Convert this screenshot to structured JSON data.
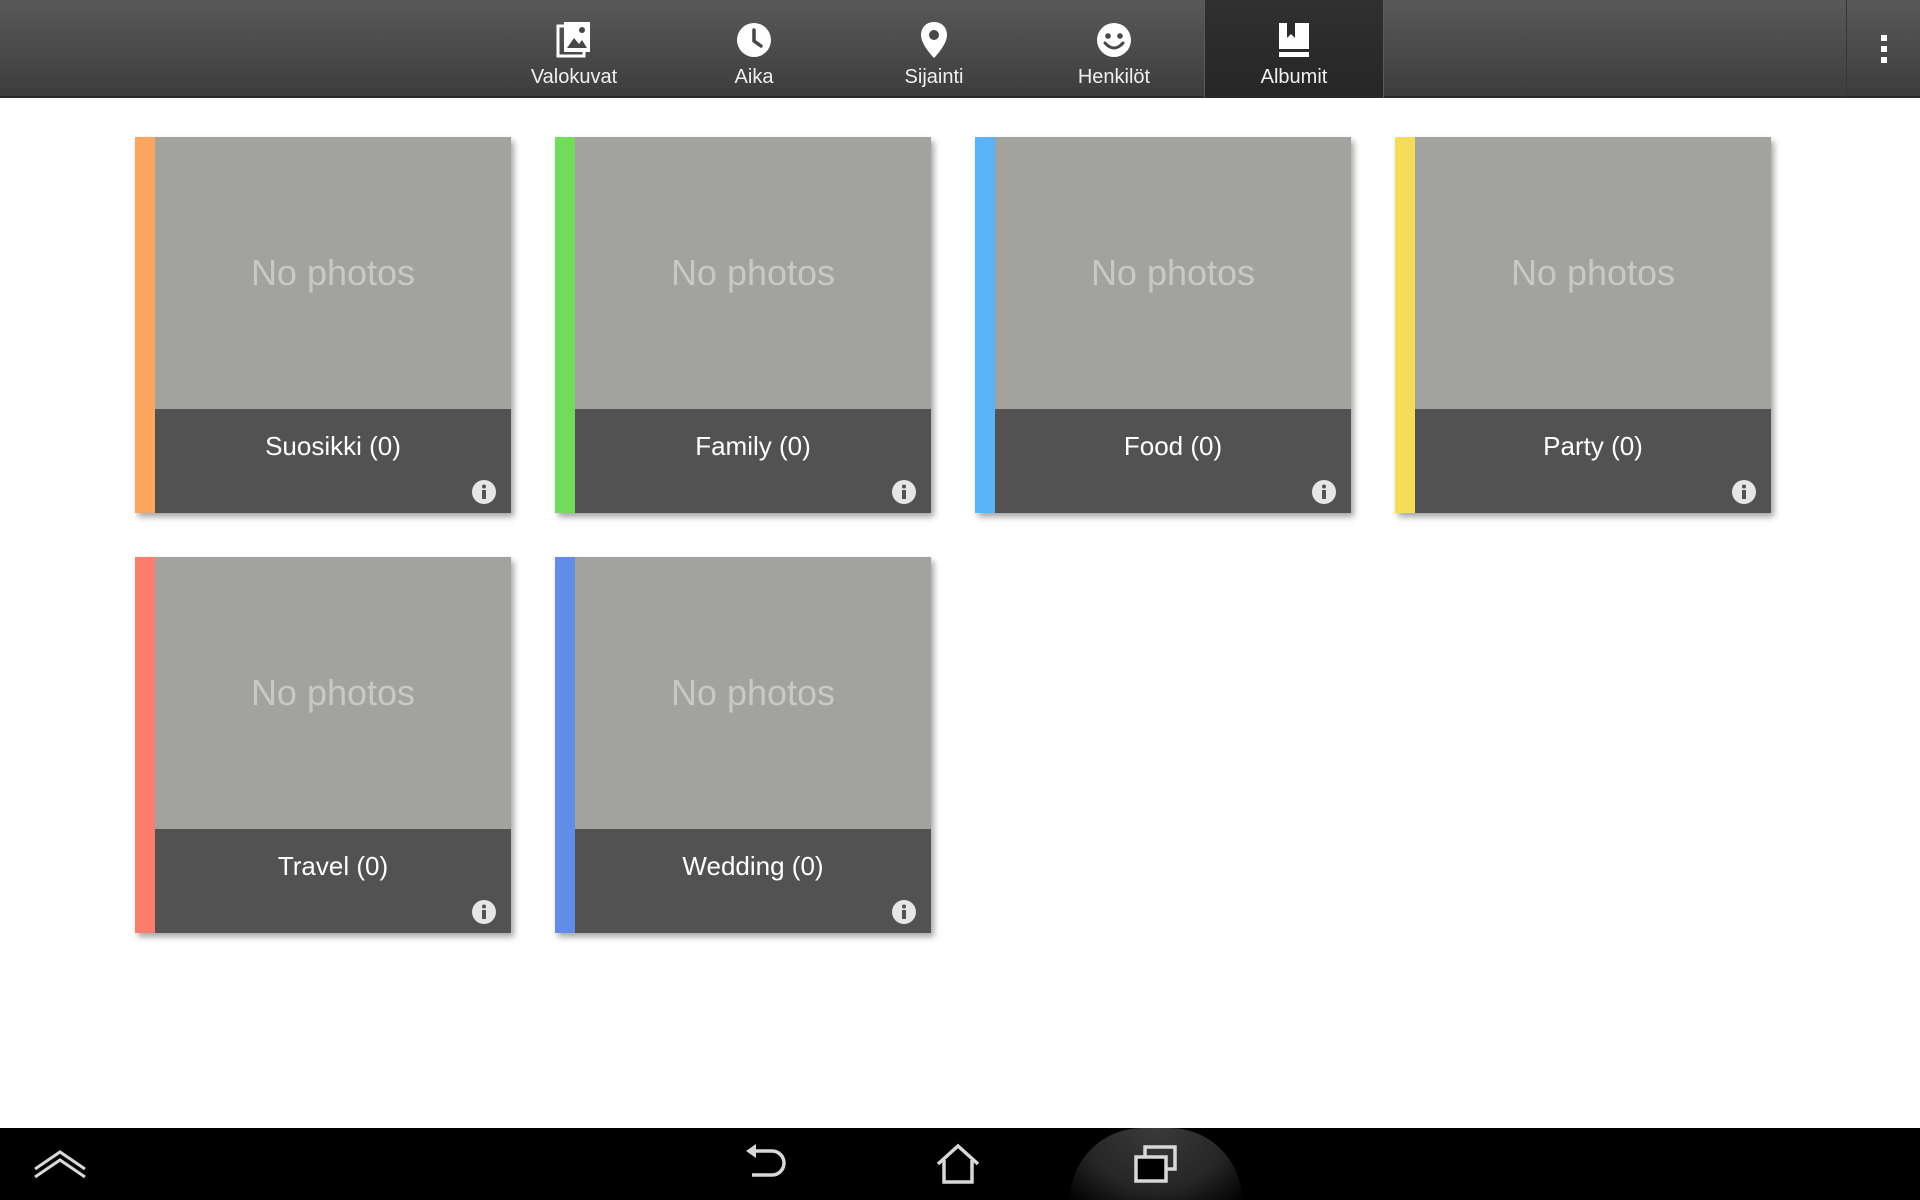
{
  "tabs": [
    {
      "label": "Valokuvat",
      "icon": "photo-icon"
    },
    {
      "label": "Aika",
      "icon": "clock-icon"
    },
    {
      "label": "Sijainti",
      "icon": "location-pin-icon"
    },
    {
      "label": "Henkilöt",
      "icon": "smiley-icon"
    },
    {
      "label": "Albumit",
      "icon": "album-book-icon"
    }
  ],
  "active_tab": "Albumit",
  "albums": [
    {
      "placeholder": "No photos",
      "title": "Suosikki (0)",
      "color": "#fca55f"
    },
    {
      "placeholder": "No photos",
      "title": "Family (0)",
      "color": "#72db5a"
    },
    {
      "placeholder": "No photos",
      "title": "Food (0)",
      "color": "#5ab3f6"
    },
    {
      "placeholder": "No photos",
      "title": "Party (0)",
      "color": "#f6dd58"
    },
    {
      "placeholder": "No photos",
      "title": "Travel (0)",
      "color": "#fb7d6c"
    },
    {
      "placeholder": "No photos",
      "title": "Wedding (0)",
      "color": "#5f8de8"
    }
  ],
  "navbar": {
    "icons": [
      "menu-up-icon",
      "back-icon",
      "home-icon",
      "recent-apps-icon"
    ]
  }
}
